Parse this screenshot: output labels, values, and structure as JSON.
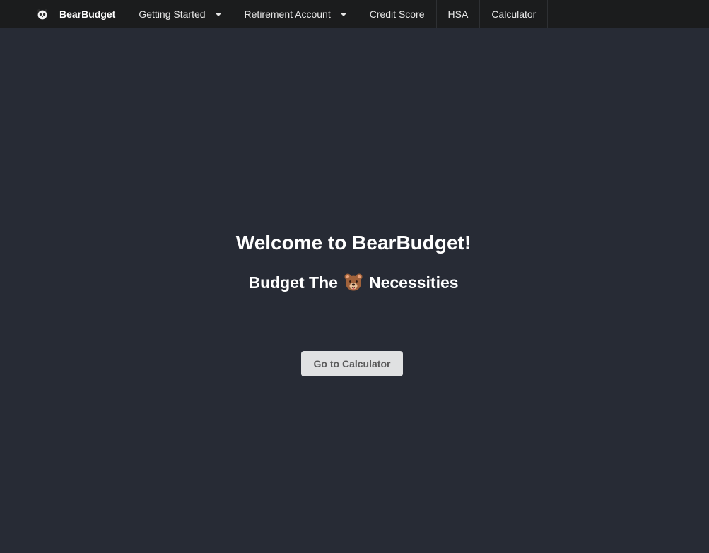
{
  "navbar": {
    "brand_icon": "panda-icon",
    "brand": "BearBudget",
    "items": [
      {
        "label": "Getting Started",
        "has_dropdown": true
      },
      {
        "label": "Retirement Account",
        "has_dropdown": true
      },
      {
        "label": "Credit Score",
        "has_dropdown": false
      },
      {
        "label": "HSA",
        "has_dropdown": false
      },
      {
        "label": "Calculator",
        "has_dropdown": false
      }
    ]
  },
  "hero": {
    "title": "Welcome to BearBudget!",
    "subtitle_before": "Budget The",
    "subtitle_icon": "bear-face-icon",
    "subtitle_after": "Necessities",
    "cta_label": "Go to Calculator"
  },
  "colors": {
    "background": "#272b35",
    "navbar": "#1b1c1d",
    "button": "#e0e1e2"
  }
}
